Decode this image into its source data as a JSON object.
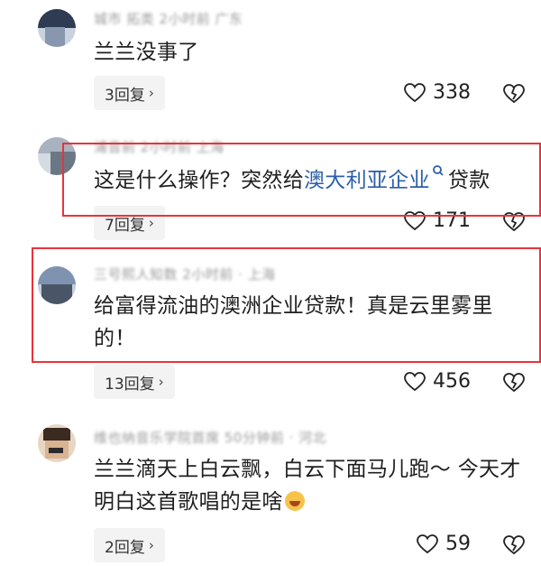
{
  "comments": [
    {
      "meta": "城市 拓类 2小时前 广东",
      "text": "兰兰没事了",
      "replies": "3回复",
      "likes": "338"
    },
    {
      "meta": "浦音前 2小时前 上海",
      "text_before": "这是什么操作？突然给",
      "link": "澳大利亚企业",
      "text_after": "贷款",
      "replies": "7回复",
      "likes": "171"
    },
    {
      "meta": "三号熙人知数 2小时前 · 上海",
      "text": "给富得流油的澳洲企业贷款！真是云里雾里的！",
      "replies": "13回复",
      "likes": "456"
    },
    {
      "meta": "维也纳音乐学院首席 50分钟前 · 河北",
      "text": "兰兰滴天上白云飘，白云下面马儿跑～ 今天才明白这首歌唱的是啥",
      "replies": "2回复",
      "likes": "59"
    }
  ],
  "icons": {
    "heart": "heart-icon",
    "dislike": "broken-heart-icon",
    "chevron": "chevron-right-icon",
    "search": "search-icon",
    "emoji": "laughing-crying-emoji"
  },
  "colors": {
    "highlight_box": "#e8343a",
    "link": "#2b5fa8",
    "reply_bg": "#f3f3f3"
  }
}
